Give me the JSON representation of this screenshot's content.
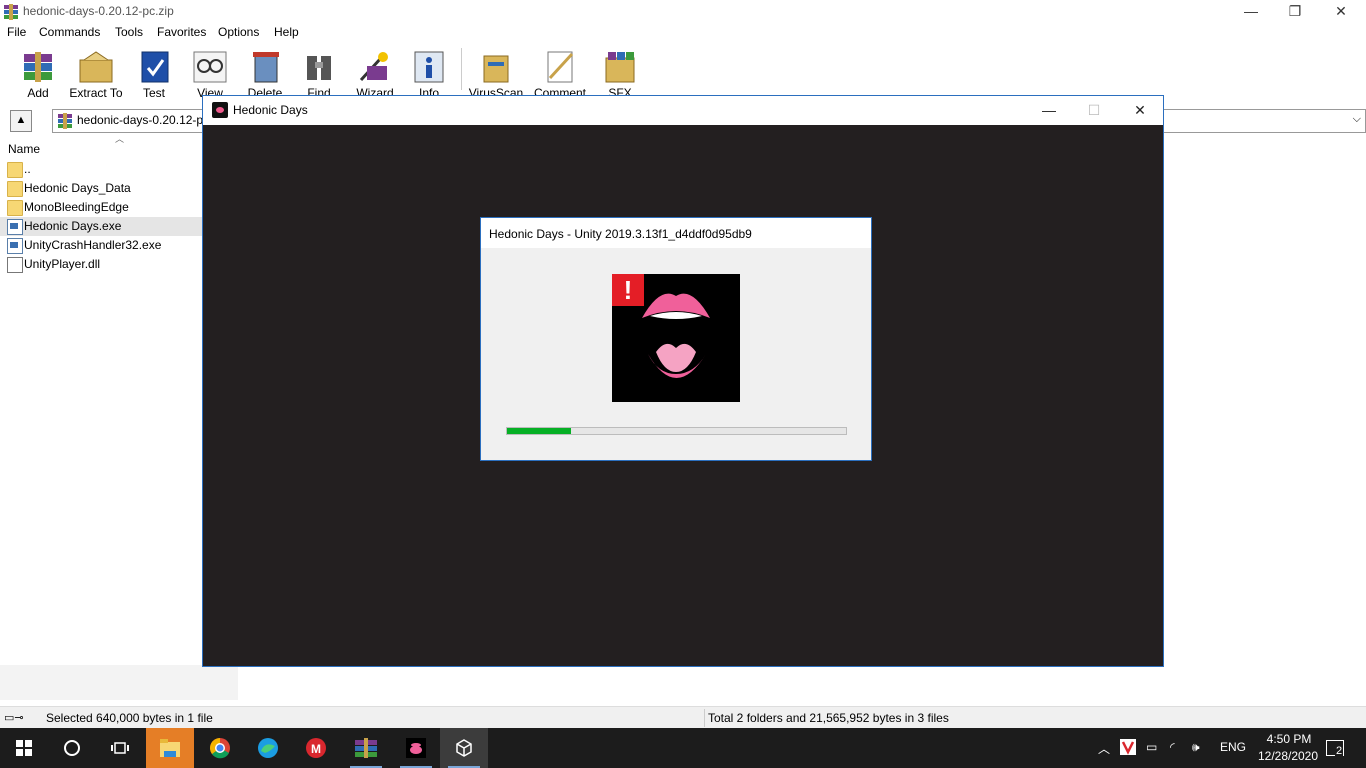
{
  "winrar": {
    "title": "hedonic-days-0.20.12-pc.zip",
    "caption": {
      "minimize": "—",
      "restore": "❐",
      "close": "✕"
    },
    "menu": [
      "File",
      "Commands",
      "Tools",
      "Favorites",
      "Options",
      "Help"
    ],
    "toolbar": [
      {
        "label": "Add",
        "icon": "add-archive-icon"
      },
      {
        "label": "Extract To",
        "icon": "extract-to-icon"
      },
      {
        "label": "Test",
        "icon": "test-icon"
      },
      {
        "label": "View",
        "icon": "view-icon"
      },
      {
        "label": "Delete",
        "icon": "delete-icon"
      },
      {
        "label": "Find",
        "icon": "find-icon"
      },
      {
        "label": "Wizard",
        "icon": "wizard-icon"
      },
      {
        "label": "Info",
        "icon": "info-icon"
      },
      {
        "label": "VirusScan",
        "icon": "virusscan-icon"
      },
      {
        "label": "Comment",
        "icon": "comment-icon"
      },
      {
        "label": "SFX",
        "icon": "sfx-icon"
      }
    ],
    "path": "hedonic-days-0.20.12-p",
    "column_name": "Name",
    "files": [
      {
        "name": "..",
        "type": "folder"
      },
      {
        "name": "Hedonic Days_Data",
        "type": "folder"
      },
      {
        "name": "MonoBleedingEdge",
        "type": "folder"
      },
      {
        "name": "Hedonic Days.exe",
        "type": "exe",
        "selected": true
      },
      {
        "name": "UnityCrashHandler32.exe",
        "type": "exe"
      },
      {
        "name": "UnityPlayer.dll",
        "type": "dll"
      }
    ],
    "status_left": "Selected 640,000 bytes in 1 file",
    "status_right": "Total 2 folders and 21,565,952 bytes in 3 files"
  },
  "game": {
    "title": "Hedonic Days",
    "caption": {
      "minimize": "—",
      "maximize": "☐",
      "close": "✕"
    }
  },
  "splash": {
    "title": "Hedonic Days - Unity 2019.3.13f1_d4ddf0d95db9",
    "alert": "!",
    "progress": 0.19,
    "colors": {
      "progress": "#06b025",
      "alert": "#e41e26",
      "lips": "#f0609a"
    }
  },
  "taskbar": {
    "apps": [
      "start-icon",
      "cortana-icon",
      "task-view-icon",
      "file-explorer-icon",
      "chrome-icon",
      "edge-icon",
      "mega-icon",
      "winrar-icon",
      "hedonic-days-icon",
      "unity-icon"
    ],
    "language": "ENG",
    "time": "4:50 PM",
    "date": "12/28/2020",
    "notifications": "2"
  }
}
